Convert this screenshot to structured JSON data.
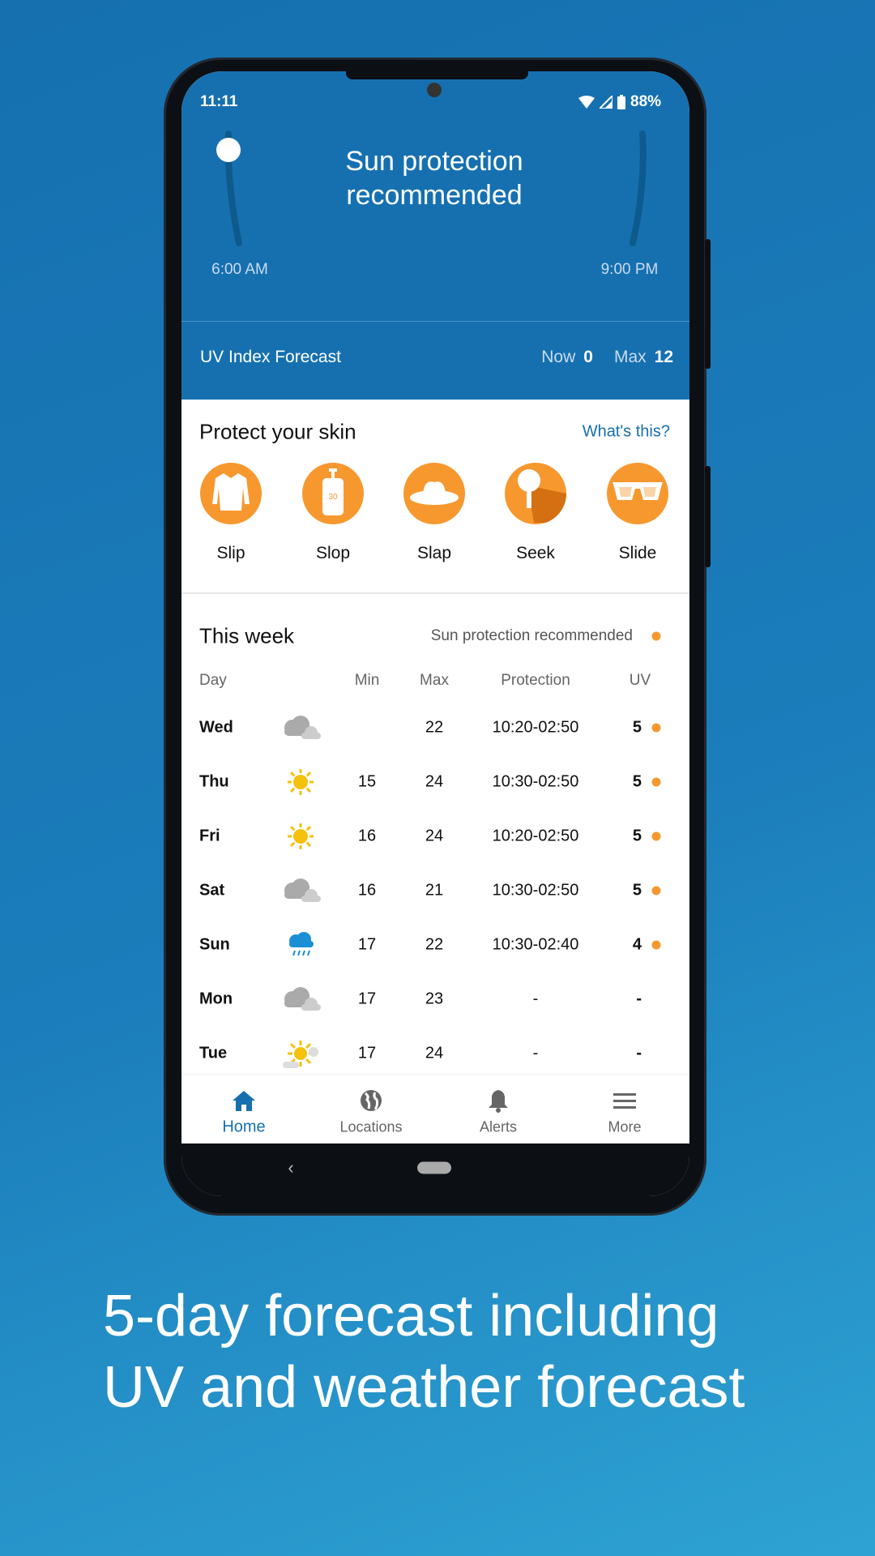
{
  "status": {
    "time": "11:11",
    "battery": "88%"
  },
  "header": {
    "title_line1": "Sun protection",
    "title_line2": "recommended",
    "start_time": "6:00 AM",
    "end_time": "9:00 PM"
  },
  "uv_bar": {
    "label": "UV Index Forecast",
    "now_label": "Now",
    "now_value": "0",
    "max_label": "Max",
    "max_value": "12"
  },
  "protect": {
    "title": "Protect your skin",
    "link": "What's this?",
    "items": [
      {
        "label": "Slip",
        "icon": "shirt-icon"
      },
      {
        "label": "Slop",
        "icon": "sunscreen-icon",
        "badge": "30"
      },
      {
        "label": "Slap",
        "icon": "hat-icon"
      },
      {
        "label": "Seek",
        "icon": "tree-shade-icon"
      },
      {
        "label": "Slide",
        "icon": "sunglasses-icon"
      }
    ]
  },
  "week": {
    "title": "This week",
    "legend": "Sun protection recommended",
    "columns": [
      "Day",
      "Min",
      "Max",
      "Protection",
      "UV"
    ],
    "rows": [
      {
        "day": "Wed",
        "icon": "cloudy",
        "min": "",
        "max": "22",
        "protection": "10:20-02:50",
        "uv": "5",
        "dot": true
      },
      {
        "day": "Thu",
        "icon": "sunny",
        "min": "15",
        "max": "24",
        "protection": "10:30-02:50",
        "uv": "5",
        "dot": true
      },
      {
        "day": "Fri",
        "icon": "sunny",
        "min": "16",
        "max": "24",
        "protection": "10:20-02:50",
        "uv": "5",
        "dot": true
      },
      {
        "day": "Sat",
        "icon": "cloudy",
        "min": "16",
        "max": "21",
        "protection": "10:30-02:50",
        "uv": "5",
        "dot": true
      },
      {
        "day": "Sun",
        "icon": "rain",
        "min": "17",
        "max": "22",
        "protection": "10:30-02:40",
        "uv": "4",
        "dot": true
      },
      {
        "day": "Mon",
        "icon": "cloudy",
        "min": "17",
        "max": "23",
        "protection": "-",
        "uv": "-",
        "dot": false
      },
      {
        "day": "Tue",
        "icon": "partly-sunny",
        "min": "17",
        "max": "24",
        "protection": "-",
        "uv": "-",
        "dot": false
      }
    ]
  },
  "nav": [
    {
      "label": "Home",
      "icon": "home-icon",
      "active": true
    },
    {
      "label": "Locations",
      "icon": "globe-icon"
    },
    {
      "label": "Alerts",
      "icon": "bell-icon"
    },
    {
      "label": "More",
      "icon": "menu-icon"
    }
  ],
  "colors": {
    "brand": "#1670b0",
    "accent": "#f7982f",
    "link": "#1670b0"
  },
  "caption": {
    "line1": "5-day forecast including",
    "line2": "UV and weather forecast"
  }
}
